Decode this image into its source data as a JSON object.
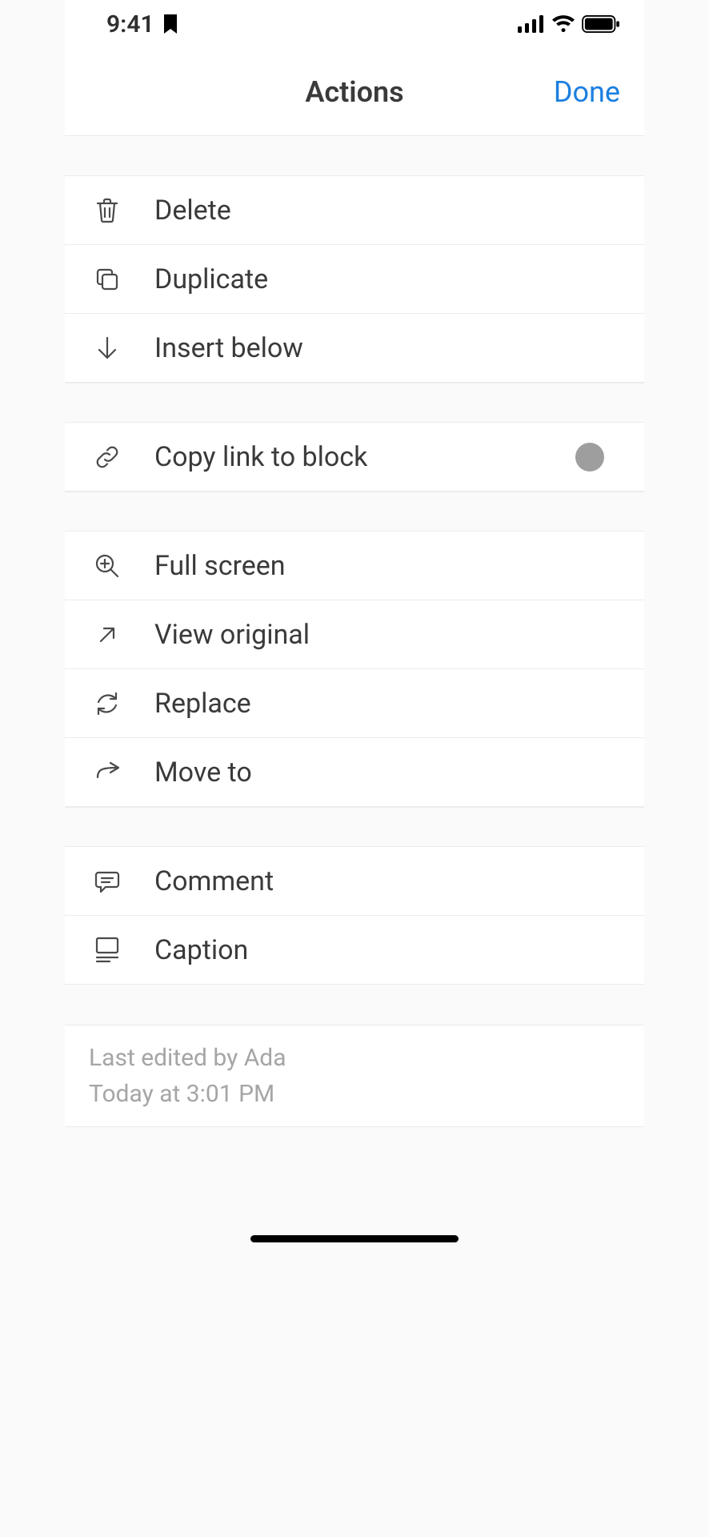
{
  "status": {
    "time": "9:41"
  },
  "header": {
    "title": "Actions",
    "done": "Done"
  },
  "groups": {
    "g1": {
      "delete": "Delete",
      "duplicate": "Duplicate",
      "insert_below": "Insert below"
    },
    "g2": {
      "copy_link": "Copy link to block"
    },
    "g3": {
      "full_screen": "Full screen",
      "view_original": "View original",
      "replace": "Replace",
      "move_to": "Move to"
    },
    "g4": {
      "comment": "Comment",
      "caption": "Caption"
    }
  },
  "footer": {
    "edited_by": "Last edited by Ada",
    "timestamp": "Today at 3:01 PM"
  }
}
